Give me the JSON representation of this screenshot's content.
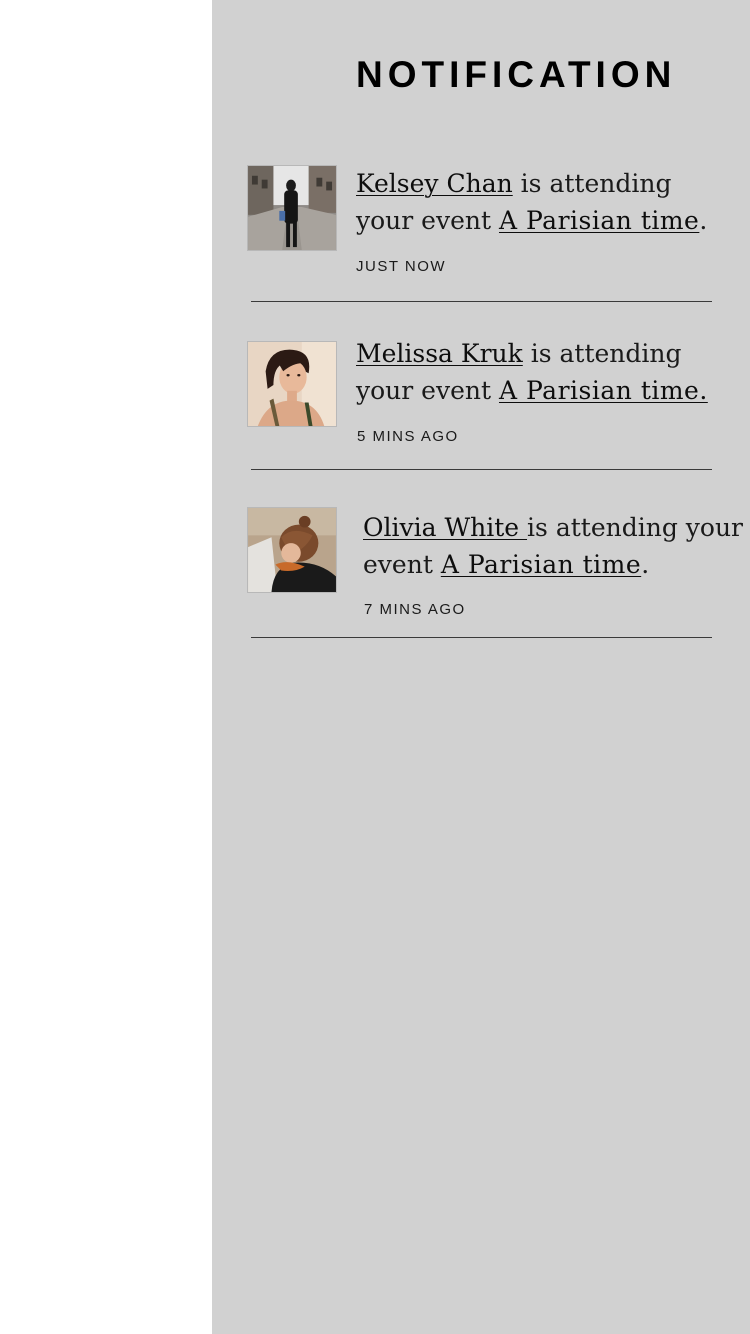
{
  "header": {
    "title": "NOTIFICATION"
  },
  "notifications": [
    {
      "name": "Kelsey Chan",
      "action_pre": " is attending your event ",
      "event": "A Parisian time",
      "punct": ".",
      "time": "JUST NOW",
      "avatar_icon": "street-portrait-photo"
    },
    {
      "name": "Melissa Kruk",
      "action_pre": " is attending your event ",
      "event": "A Parisian time.",
      "punct": "",
      "time": "5 MINS AGO",
      "avatar_icon": "portrait-photo"
    },
    {
      "name": "Olivia White ",
      "action_pre": "is attending your event ",
      "event": "A Parisian time",
      "punct": ".",
      "time": "7 MINS AGO",
      "avatar_icon": "portrait-photo"
    }
  ],
  "colors": {
    "panel_bg": "#d1d1d1",
    "text": "#0d0d0d",
    "divider": "#3a3a3a"
  }
}
